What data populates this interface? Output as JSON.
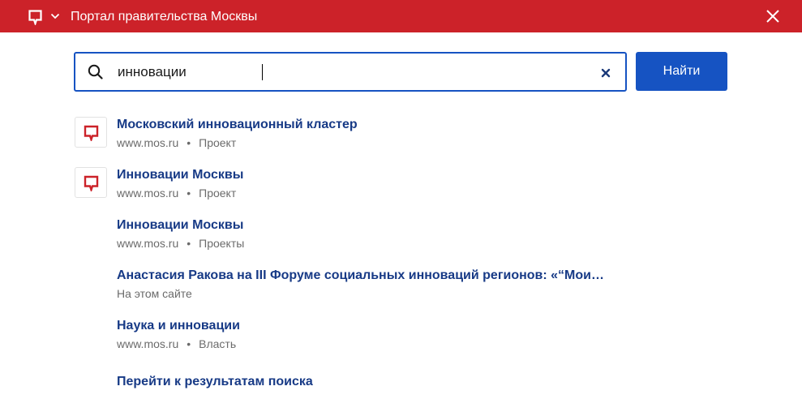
{
  "header": {
    "title": "Портал правительства Москвы",
    "logo_icon": "mos-logo-icon",
    "menu_icon": "chevron-down-icon",
    "close_icon": "close-icon",
    "background_color": "#cc2229"
  },
  "search": {
    "value": "инновации",
    "search_icon": "search-icon",
    "clear_icon": "clear-icon",
    "button_label": "Найти",
    "accent_color": "#1653c2"
  },
  "results": [
    {
      "title": "Московский инновационный кластер",
      "source": "www.mos.ru",
      "separator": "•",
      "category": "Проект",
      "has_icon": true
    },
    {
      "title": "Инновации Москвы",
      "source": "www.mos.ru",
      "separator": "•",
      "category": "Проект",
      "has_icon": true
    },
    {
      "title": "Инновации Москвы",
      "source": "www.mos.ru",
      "separator": "•",
      "category": "Проекты",
      "has_icon": false
    },
    {
      "title": "Анастасия Ракова на III Форуме социальных инноваций регионов: «“Мои…",
      "source": "На этом сайте",
      "has_icon": false
    },
    {
      "title": "Наука и инновации",
      "source": "www.mos.ru",
      "separator": "•",
      "category": "Власть",
      "has_icon": false
    }
  ],
  "goto_results_label": "Перейти к результатам поиска"
}
